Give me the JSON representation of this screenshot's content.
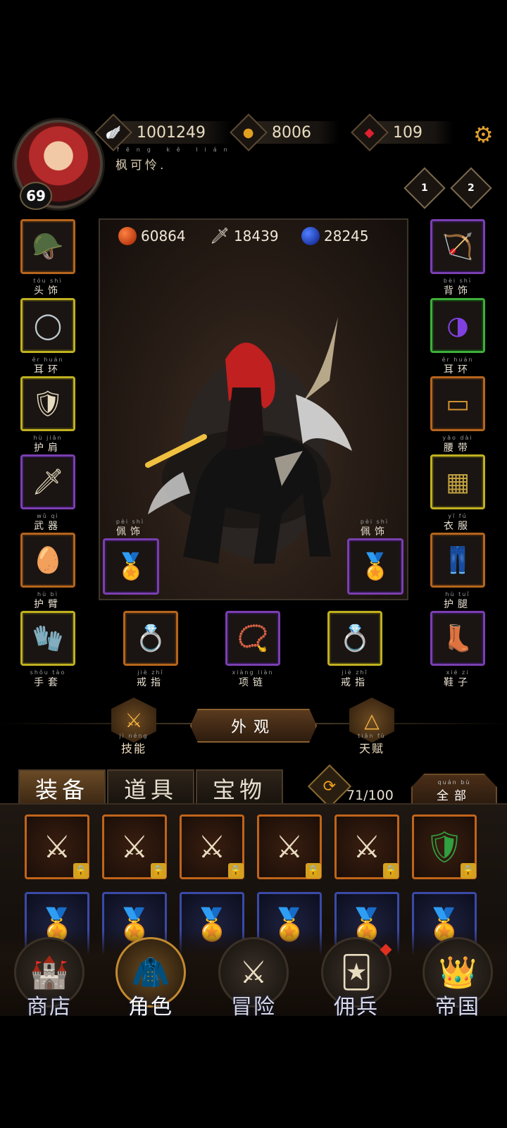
{
  "header": {
    "level": "69",
    "player_name": "枫可怜.",
    "player_name_pinyin": "fēng kě lián",
    "resources": [
      {
        "icon": "wings-icon",
        "value": "1001249"
      },
      {
        "icon": "gold-coin-icon",
        "value": "8006"
      },
      {
        "icon": "red-gem-icon",
        "value": "109"
      }
    ],
    "rank_badges": [
      "1",
      "2"
    ]
  },
  "stats": [
    {
      "icon": "hp-orb-icon",
      "value": "60864",
      "color": "#d04010"
    },
    {
      "icon": "sword-icon",
      "value": "18439",
      "color": "#c0c0c0"
    },
    {
      "icon": "mp-orb-icon",
      "value": "28245",
      "color": "#2040d0"
    }
  ],
  "equipment": {
    "left": [
      {
        "label": "头饰",
        "pinyin": "tóu shì",
        "quality": "orange",
        "icon": "helmet-icon"
      },
      {
        "label": "耳环",
        "pinyin": "ěr huán",
        "quality": "yellow",
        "icon": "earring-icon"
      },
      {
        "label": "护肩",
        "pinyin": "hù jiān",
        "quality": "yellow",
        "icon": "pauldron-icon"
      },
      {
        "label": "武器",
        "pinyin": "wǔ qì",
        "quality": "purple",
        "icon": "sword-icon"
      },
      {
        "label": "护臂",
        "pinyin": "hù bì",
        "quality": "orange",
        "icon": "bracer-icon"
      }
    ],
    "right": [
      {
        "label": "背饰",
        "pinyin": "bèi shì",
        "quality": "purple",
        "icon": "bow-icon"
      },
      {
        "label": "耳环",
        "pinyin": "ěr huán",
        "quality": "green",
        "icon": "earring-icon"
      },
      {
        "label": "腰带",
        "pinyin": "yāo dài",
        "quality": "orange",
        "icon": "belt-icon"
      },
      {
        "label": "衣服",
        "pinyin": "yī fú",
        "quality": "yellow",
        "icon": "armor-icon"
      },
      {
        "label": "护腿",
        "pinyin": "hù tuǐ",
        "quality": "orange",
        "icon": "greaves-icon"
      }
    ],
    "bottom": [
      {
        "label": "手套",
        "pinyin": "shǒu tào",
        "quality": "yellow",
        "icon": "gloves-icon"
      },
      {
        "label": "戒指",
        "pinyin": "jiè zhǐ",
        "quality": "orange",
        "icon": "ring-icon"
      },
      {
        "label": "项链",
        "pinyin": "xiàng liàn",
        "quality": "purple",
        "icon": "necklace-icon"
      },
      {
        "label": "戒指",
        "pinyin": "jiè zhǐ",
        "quality": "yellow",
        "icon": "ring-icon"
      },
      {
        "label": "鞋子",
        "pinyin": "xié zi",
        "quality": "purple",
        "icon": "boots-icon"
      }
    ],
    "accessory_left": {
      "label": "佩饰",
      "pinyin": "pèi shì"
    },
    "accessory_right": {
      "label": "佩饰",
      "pinyin": "pèi shì"
    }
  },
  "actions": {
    "skill": {
      "label": "技能",
      "pinyin": "jì néng"
    },
    "appearance": "外观",
    "talent": {
      "label": "天赋",
      "pinyin": "tiān fù"
    }
  },
  "tabs": [
    "装备",
    "道具",
    "宝物"
  ],
  "inventory": {
    "capacity": "71/100",
    "filter": "全部",
    "filter_pinyin": "quán bù"
  },
  "nav": [
    {
      "label": "商店",
      "icon": "castle-icon"
    },
    {
      "label": "角色",
      "icon": "hooded-figure-icon"
    },
    {
      "label": "冒险",
      "icon": "crossed-swords-icon"
    },
    {
      "label": "佣兵",
      "icon": "mercenary-cards-icon"
    },
    {
      "label": "帝国",
      "icon": "crown-icon"
    }
  ],
  "colors": {
    "orange": "#b5651d",
    "yellow": "#c0b020",
    "purple": "#7a3fb0",
    "green": "#3fae3a",
    "accent": "#c08a30"
  }
}
